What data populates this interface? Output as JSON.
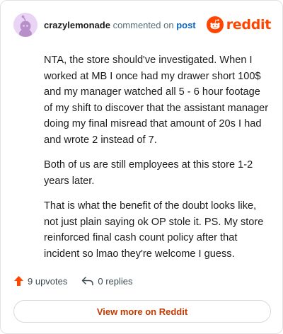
{
  "header": {
    "username": "crazylemonade",
    "commented_text": "commented on",
    "post_link": "post",
    "logo_text": "reddit"
  },
  "comment": {
    "paragraphs": [
      "NTA, the store should've investigated. When I worked at MB I once had my drawer short 100$ and my manager watched all 5 - 6 hour footage of my shift to discover that the assistant manager doing my final misread that amount of 20s I had and wrote 2 instead of 7.",
      "Both of us are still employees at this store 1-2 years later.",
      "That is what the benefit of the doubt looks like, not just plain saying ok OP stole it. PS. My store reinforced final cash count policy after that incident so lmao they're welcome I guess."
    ]
  },
  "actions": {
    "upvotes": "9 upvotes",
    "replies": "0 replies"
  },
  "view_more": "View more on Reddit",
  "colors": {
    "brand": "#ff4500",
    "avatar_bg": "#e9d4f5",
    "link": "#0a66c2",
    "view_more_text": "#c03a00"
  },
  "icons": {
    "avatar": "snoo-avatar-icon",
    "logo": "reddit-snoo-icon",
    "upvote": "upvote-arrow-icon",
    "reply": "reply-arrow-icon"
  }
}
